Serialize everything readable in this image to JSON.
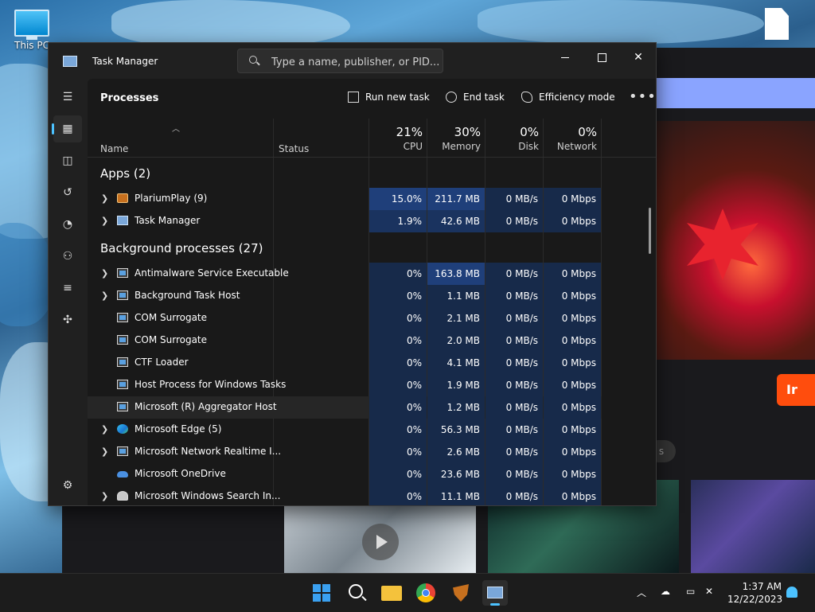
{
  "desktop": {
    "this_pc_label": "This PC"
  },
  "browser": {
    "cta_text": "Ir",
    "pill_text": "s"
  },
  "window": {
    "title": "Task Manager",
    "search_placeholder": "Type a name, publisher, or PID..."
  },
  "toolbar": {
    "page_title": "Processes",
    "run_new_task": "Run new task",
    "end_task": "End task",
    "efficiency_mode": "Efficiency mode",
    "more": "•••"
  },
  "columns": {
    "name": "Name",
    "status": "Status",
    "cpu": {
      "pct": "21%",
      "label": "CPU"
    },
    "memory": {
      "pct": "30%",
      "label": "Memory"
    },
    "disk": {
      "pct": "0%",
      "label": "Disk"
    },
    "network": {
      "pct": "0%",
      "label": "Network"
    }
  },
  "groups": {
    "apps": "Apps (2)",
    "background": "Background processes (27)"
  },
  "apps": [
    {
      "name": "PlariumPlay (9)",
      "cpu": "15.0%",
      "mem": "211.7 MB",
      "disk": "0 MB/s",
      "net": "0 Mbps"
    },
    {
      "name": "Task Manager",
      "cpu": "1.9%",
      "mem": "42.6 MB",
      "disk": "0 MB/s",
      "net": "0 Mbps"
    }
  ],
  "background": [
    {
      "name": "Antimalware Service Executable",
      "cpu": "0%",
      "mem": "163.8 MB",
      "disk": "0 MB/s",
      "net": "0 Mbps"
    },
    {
      "name": "Background Task Host",
      "cpu": "0%",
      "mem": "1.1 MB",
      "disk": "0 MB/s",
      "net": "0 Mbps"
    },
    {
      "name": "COM Surrogate",
      "cpu": "0%",
      "mem": "2.1 MB",
      "disk": "0 MB/s",
      "net": "0 Mbps"
    },
    {
      "name": "COM Surrogate",
      "cpu": "0%",
      "mem": "2.0 MB",
      "disk": "0 MB/s",
      "net": "0 Mbps"
    },
    {
      "name": "CTF Loader",
      "cpu": "0%",
      "mem": "4.1 MB",
      "disk": "0 MB/s",
      "net": "0 Mbps"
    },
    {
      "name": "Host Process for Windows Tasks",
      "cpu": "0%",
      "mem": "1.9 MB",
      "disk": "0 MB/s",
      "net": "0 Mbps"
    },
    {
      "name": "Microsoft (R) Aggregator Host",
      "cpu": "0%",
      "mem": "1.2 MB",
      "disk": "0 MB/s",
      "net": "0 Mbps"
    },
    {
      "name": "Microsoft Edge (5)",
      "cpu": "0%",
      "mem": "56.3 MB",
      "disk": "0 MB/s",
      "net": "0 Mbps"
    },
    {
      "name": "Microsoft Network Realtime I...",
      "cpu": "0%",
      "mem": "2.6 MB",
      "disk": "0 MB/s",
      "net": "0 Mbps"
    },
    {
      "name": "Microsoft OneDrive",
      "cpu": "0%",
      "mem": "23.6 MB",
      "disk": "0 MB/s",
      "net": "0 Mbps"
    },
    {
      "name": "Microsoft Windows Search In...",
      "cpu": "0%",
      "mem": "11.1 MB",
      "disk": "0 MB/s",
      "net": "0 Mbps"
    }
  ],
  "colors": {
    "heat_high": "#1f3f7a",
    "heat_mid": "#1a335f",
    "heat_low": "#172a4a",
    "accent": "#4cc2ff"
  },
  "taskbar": {
    "time": "1:37 AM",
    "date": "12/22/2023"
  }
}
